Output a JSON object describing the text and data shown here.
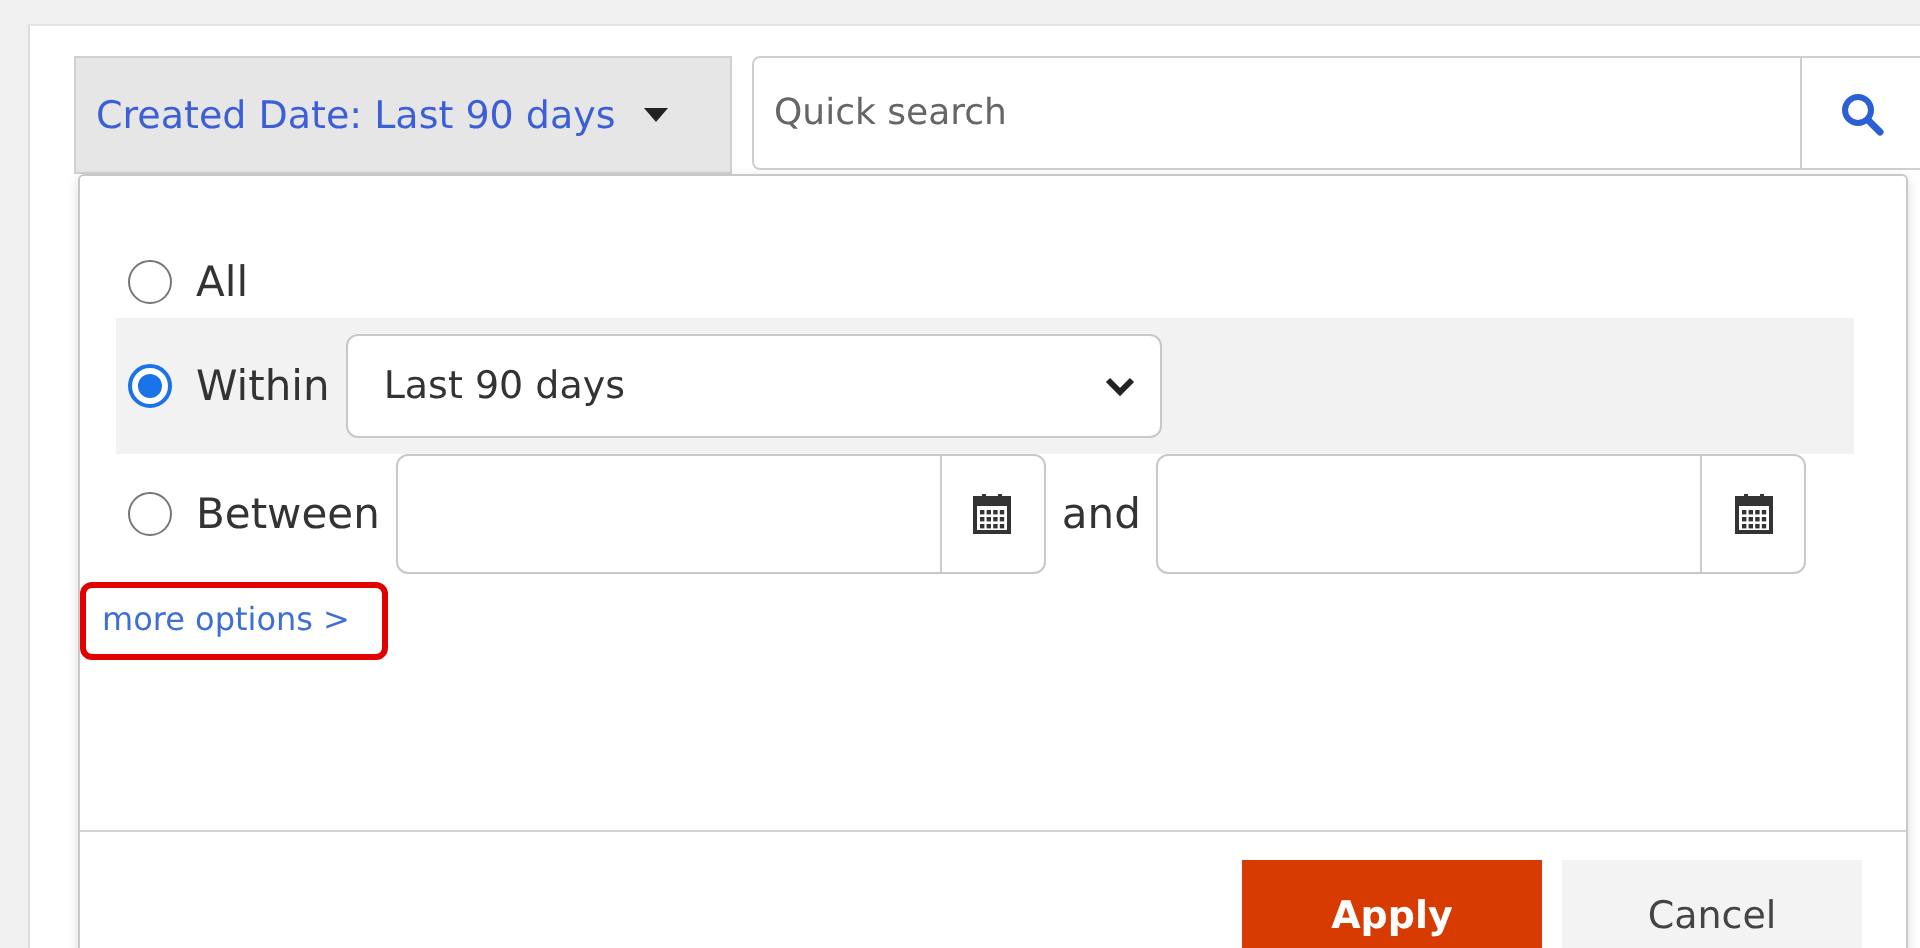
{
  "filter_button": {
    "label": "Created Date: Last 90 days",
    "expanded": true
  },
  "search": {
    "placeholder": "Quick search"
  },
  "popup": {
    "options": [
      {
        "kind": "plain",
        "label": "All",
        "selected": false
      },
      {
        "kind": "select",
        "label": "Within",
        "selected": true,
        "value": "Last 90 days"
      },
      {
        "kind": "range",
        "label": "Between",
        "selected": false,
        "joiner": "and"
      }
    ],
    "more_options": {
      "label": "more options >",
      "highlighted": true
    },
    "buttons": [
      {
        "label": "Apply",
        "kind": "primary"
      },
      {
        "label": "Cancel",
        "kind": "secondary"
      }
    ]
  }
}
